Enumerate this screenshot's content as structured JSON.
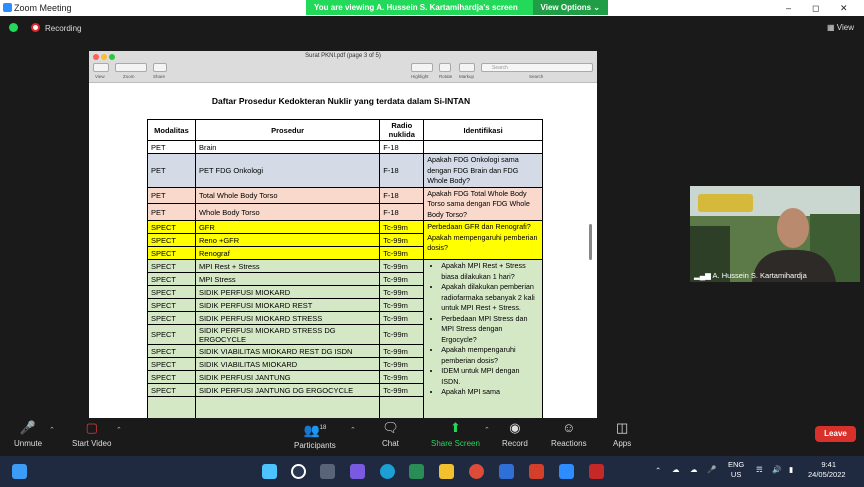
{
  "window": {
    "title": "Zoom Meeting"
  },
  "banner": {
    "text": "You are viewing A. Hussein S. Kartamihardja's screen",
    "view_options": "View Options"
  },
  "topbar": {
    "recording": "Recording",
    "view": "View"
  },
  "preview": {
    "title": "Surat PKNI.pdf (page 3 of 5)",
    "search_placeholder": "Search",
    "labels": {
      "view": "View",
      "zoom": "Zoom",
      "share": "Share",
      "highlight": "Highlight",
      "rotate": "Rotate",
      "markup": "Markup",
      "search": "Search"
    }
  },
  "doc": {
    "title": "Daftar Prosedur Kedokteran Nuklir yang terdata dalam Si-INTAN",
    "headers": [
      "Modalitas",
      "Prosedur",
      "Radio nuklida",
      "Identifikasi"
    ],
    "rows": [
      {
        "mod": "PET",
        "proc": "Brain",
        "nuc": "F-18"
      },
      {
        "mod": "PET",
        "proc": "PET FDG Onkologi",
        "nuc": "F-18"
      },
      {
        "mod": "PET",
        "proc": "Total Whole Body Torso",
        "nuc": "F-18"
      },
      {
        "mod": "PET",
        "proc": "Whole Body Torso",
        "nuc": "F-18"
      },
      {
        "mod": "SPECT",
        "proc": "GFR",
        "nuc": "Tc-99m"
      },
      {
        "mod": "SPECT",
        "proc": "Reno +GFR",
        "nuc": "Tc-99m"
      },
      {
        "mod": "SPECT",
        "proc": "Renograf",
        "nuc": "Tc-99m"
      },
      {
        "mod": "SPECT",
        "proc": "MPI Rest + Stress",
        "nuc": "Tc-99m"
      },
      {
        "mod": "SPECT",
        "proc": "MPI Stress",
        "nuc": "Tc-99m"
      },
      {
        "mod": "SPECT",
        "proc": "SIDIK  PERFUSI MIOKARD",
        "nuc": "Tc-99m"
      },
      {
        "mod": "SPECT",
        "proc": "SIDIK PERFUSI MIOKARD REST",
        "nuc": "Tc-99m"
      },
      {
        "mod": "SPECT",
        "proc": "SIDIK PERFUSI MIOKARD STRESS",
        "nuc": "Tc-99m"
      },
      {
        "mod": "SPECT",
        "proc": "SIDIK PERFUSI MIOKARD STRESS DG ERGOCYCLE",
        "nuc": "Tc-99m"
      },
      {
        "mod": "SPECT",
        "proc": "SIDIK VIABILITAS MIOKARD REST DG ISDN",
        "nuc": "Tc-99m"
      },
      {
        "mod": "SPECT",
        "proc": "SIDIK VIABILITAS MIOKARD",
        "nuc": "Tc-99m"
      },
      {
        "mod": "SPECT",
        "proc": "SIDIK PERFUSI JANTUNG",
        "nuc": "Tc-99m"
      },
      {
        "mod": "SPECT",
        "proc": "SIDIK PERFUSI JANTUNG DG ERGOCYCLE",
        "nuc": "Tc-99m"
      }
    ],
    "ident": {
      "fdg": "Apakah FDG Onkologi sama dengan FDG Brain dan FDG Whole Body?",
      "torso": "Apakah FDG Total Whole Body Torso sama dengan FDG Whole Body Torso?",
      "gfr1": "Perbedaan GFR dan Renografi?",
      "gfr2": "Apakah mempengaruhi pemberian dosis?",
      "bullets": [
        "Apakah MPI Rest + Stress biasa dilakukan 1 hari?",
        "Apakah dilakukan pemberian radiofarmaka sebanyak 2 kali untuk MPI Rest + Stress.",
        "Perbedaan MPI Stress dan MPI Stress dengan Ergocycle?",
        "Apakah mempengaruhi pemberian dosis?",
        "IDEM untuk MPI dengan ISDN.",
        "Apakah MPI sama"
      ]
    }
  },
  "participant": {
    "name": "A. Hussein S. Kartamihardja"
  },
  "controls": {
    "unmute": "Unmute",
    "start_video": "Start Video",
    "participants": "Participants",
    "participants_count": "18",
    "chat": "Chat",
    "share_screen": "Share Screen",
    "record": "Record",
    "reactions": "Reactions",
    "apps": "Apps",
    "leave": "Leave"
  },
  "taskbar": {
    "lang": "ENG",
    "region": "US",
    "time": "9:41",
    "date": "24/05/2022"
  },
  "colors": {
    "pet_blue": "#d4dbe6",
    "pet_pink": "#f8d9cc",
    "spect_yellow": "#ffff00",
    "spect_green": "#d5e8c6",
    "banner": "#23d959",
    "leave": "#d8302a"
  }
}
